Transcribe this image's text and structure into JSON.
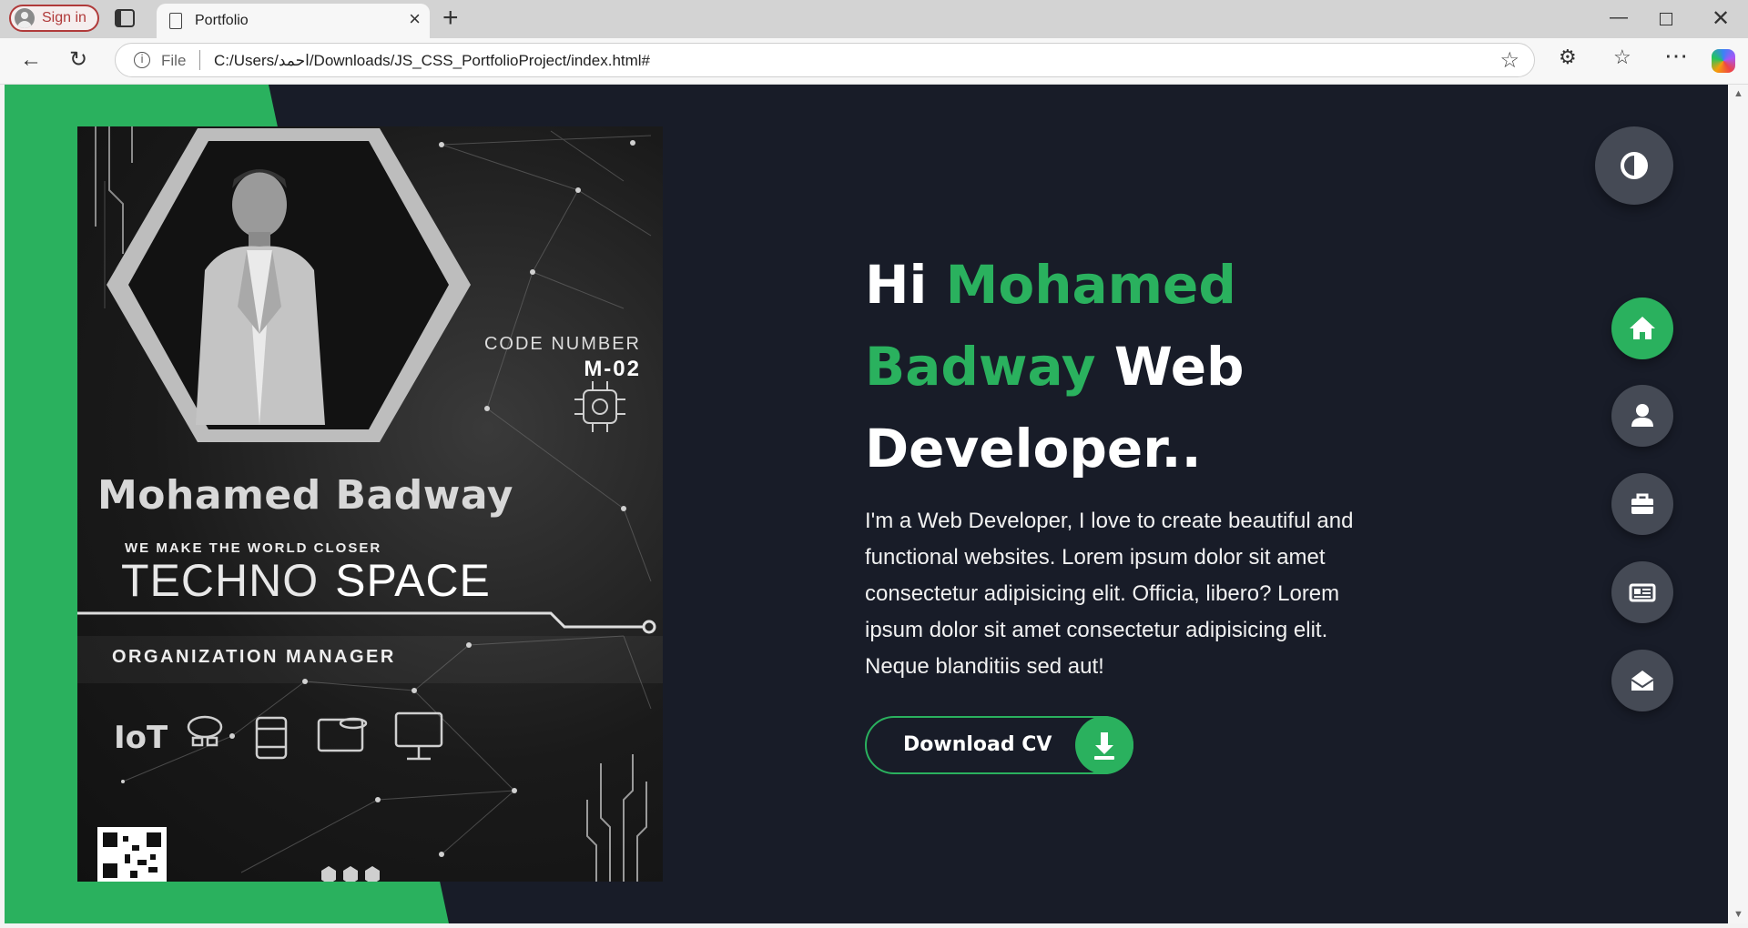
{
  "browser": {
    "signin_label": "Sign in",
    "tab_title": "Portfolio",
    "url_scheme_label": "File",
    "url": "C:/Users/احمد/Downloads/JS_CSS_PortfolioProject/index.html#"
  },
  "poster": {
    "code_label": "CODE NUMBER",
    "code_number": "M-02",
    "name": "Mohamed Badway",
    "tagline": "WE MAKE THE WORLD CLOSER",
    "brand_part1": "TECHNO",
    "brand_part2": "SPACE",
    "role": "ORGANIZATION MANAGER"
  },
  "hero": {
    "greeting": "Hi",
    "first_name": "Mohamed",
    "last_name": "Badway",
    "role_word1": "Web",
    "role_word2": "Developer..",
    "description": "I'm a Web Developer, I love to create beautiful and functional websites. Lorem ipsum dolor sit amet consectetur adipisicing elit. Officia, libero? Lorem ipsum dolor sit amet consectetur adipisicing elit. Neque blanditiis sed aut!",
    "cv_button": "Download CV"
  },
  "nav": {
    "items": [
      {
        "icon": "home-icon",
        "active": true
      },
      {
        "icon": "user-icon",
        "active": false
      },
      {
        "icon": "briefcase-icon",
        "active": false
      },
      {
        "icon": "newspaper-icon",
        "active": false
      },
      {
        "icon": "envelope-open-icon",
        "active": false
      }
    ]
  },
  "colors": {
    "accent": "#2ab15e",
    "background": "#181c28",
    "control": "#454a55"
  }
}
